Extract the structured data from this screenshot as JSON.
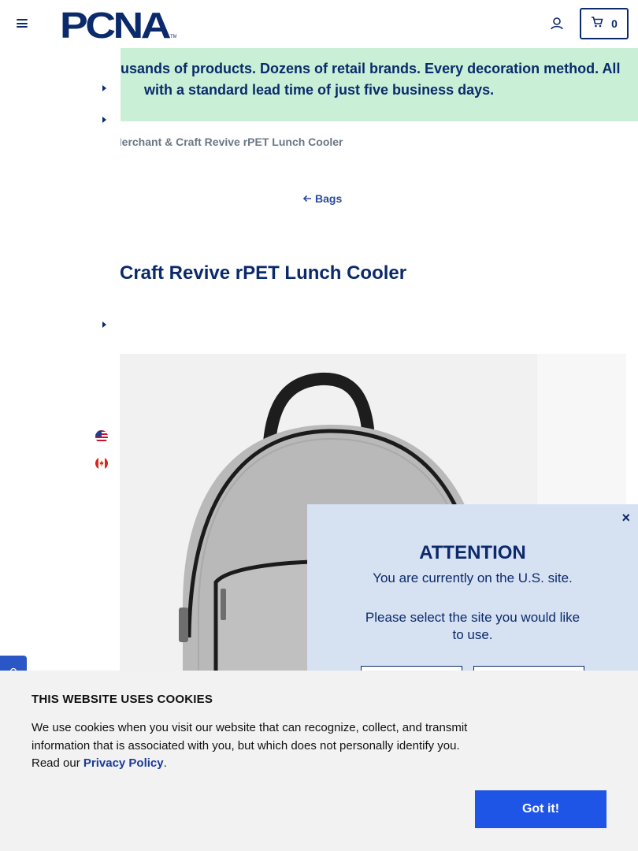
{
  "header": {
    "logo_text": "PCNA",
    "logo_trademark": "TM",
    "cart_count": "0"
  },
  "banner": {
    "line1": "usands of products. Dozens of retail brands. Every decoration method. All",
    "line2": "with a standard lead time of just five business days."
  },
  "breadcrumb": "Merchant & Craft Revive rPET Lunch Cooler",
  "back_link": "Bags",
  "product": {
    "title": "Craft Revive rPET Lunch Cooler"
  },
  "flags": [
    "us-flag-icon",
    "canada-flag-icon"
  ],
  "attention": {
    "close": "×",
    "title": "ATTENTION",
    "message1": "You are currently on the U.S. site.",
    "message2": "Please select the site you would like to use."
  },
  "cookie": {
    "title": "THIS WEBSITE USES COOKIES",
    "text": "We use cookies when you visit our website that can recognize, collect, and transmit information that is associated with you, but which does not personally identify you. Read our ",
    "link": "Privacy Policy",
    "period": ".",
    "button": "Got it!"
  },
  "colors": {
    "brand_navy": "#0b2a6b",
    "banner_green": "#c9f0d6",
    "modal_blue": "#d6e1f2",
    "cookie_button": "#1f55e6"
  }
}
